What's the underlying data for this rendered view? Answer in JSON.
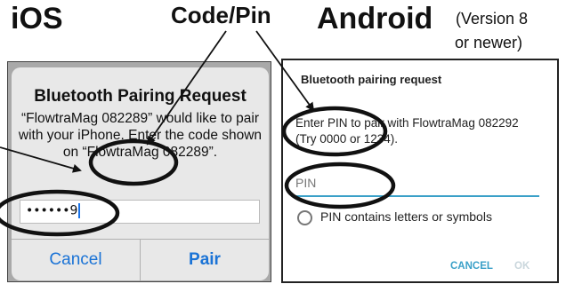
{
  "labels": {
    "ios": "iOS",
    "code_pin": "Code/Pin",
    "android": "Android",
    "android_note_line1": "(Version 8",
    "android_note_line2": "or newer)"
  },
  "ios_dialog": {
    "title": "Bluetooth Pairing Request",
    "message": "“FlowtraMag 082289” would like to pair with your iPhone. Enter the code shown on “FlowtraMag 082289”.",
    "input_value": "••••••9",
    "cancel_label": "Cancel",
    "pair_label": "Pair"
  },
  "android_dialog": {
    "title": "Bluetooth pairing request",
    "message": "Enter PIN to pair with FlowtraMag 082292 (Try 0000 or 1234).",
    "pin_placeholder": "PIN",
    "checkbox_label": "PIN contains letters or symbols",
    "cancel_label": "CANCEL",
    "ok_label": "OK"
  },
  "colors": {
    "ios_link": "#1a73d6",
    "android_accent": "#3aa0c8"
  }
}
